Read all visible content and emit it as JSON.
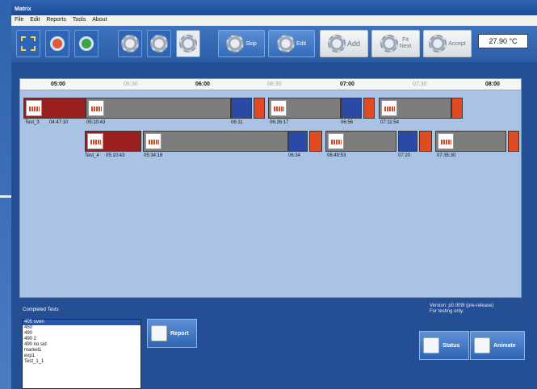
{
  "window": {
    "title": "Matrix"
  },
  "menu": [
    "File",
    "Edit",
    "Reports",
    "Tools",
    "About"
  ],
  "toolbar": {
    "skip": "Skip",
    "edit": "Edit",
    "add": "Add",
    "fit_line1": "Fit",
    "fit_line2": "Next",
    "accept": "Accept",
    "temperature": "27.90 °C"
  },
  "ruler": [
    "05:00",
    "05:30",
    "06:00",
    "06:30",
    "07:00",
    "07:30",
    "08:00"
  ],
  "timeline": {
    "row1": {
      "name": "Test_3",
      "start": "04:47:10",
      "labels": [
        "05:10:43",
        "06:11",
        "06:26:17",
        "06:56",
        "07:11:54"
      ]
    },
    "row2": {
      "name": "Test_4",
      "start": "05:10:43",
      "labels": [
        "05:34:16",
        "06:34",
        "06:49:53",
        "07:20",
        "07:35:30"
      ]
    }
  },
  "completed": {
    "title": "Completed Tests",
    "items": [
      "405 oven",
      "450",
      "490",
      "490 2",
      "490 no sid",
      "markel1",
      "exp1",
      "Test_1_1"
    ]
  },
  "buttons": {
    "report": "Report",
    "status": "Status",
    "animate": "Animate"
  },
  "version": {
    "line1": "Version: p0.009t (pre-release)",
    "line2": "For testing only."
  }
}
